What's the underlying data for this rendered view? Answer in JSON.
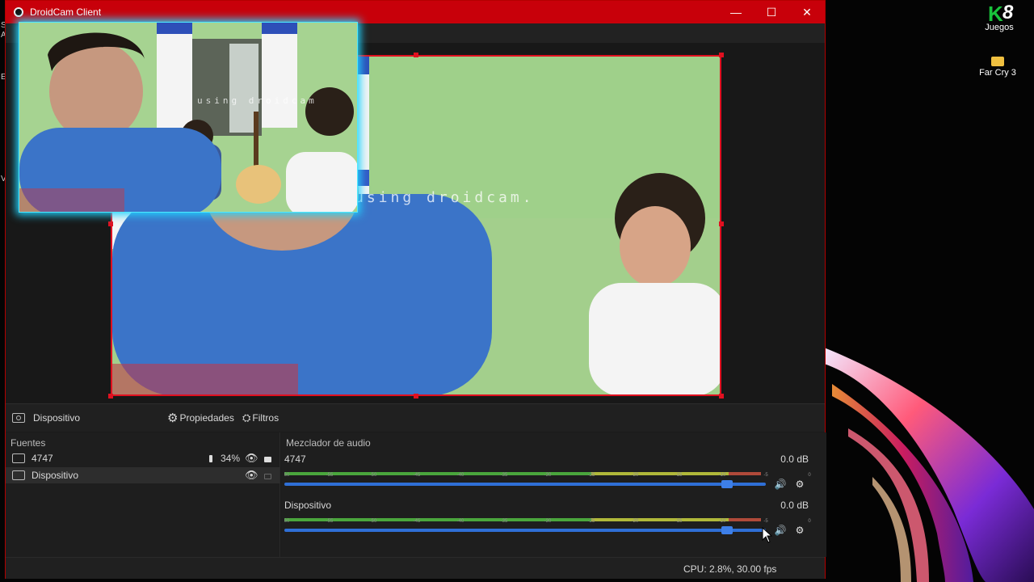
{
  "desktop": {
    "icons": [
      {
        "name": "juegos-shortcut",
        "label": "Juegos",
        "badge": "8",
        "glyph": "K",
        "color": "#19c23b"
      },
      {
        "name": "farcry-folder",
        "label": "Far Cry 3",
        "color": "#f0c040"
      }
    ],
    "edge_letters": [
      "S",
      "A",
      "E",
      "V"
    ]
  },
  "window": {
    "title": "DroidCam Client",
    "accent": "#c8000a",
    "controls": {
      "minimize": "—",
      "maximize": "☐",
      "close": "✕"
    }
  },
  "preview": {
    "watermark": "using droidcam.",
    "pip_watermark": "using droidcam",
    "selection_color": "#e01020",
    "pip_glow_color": "#21d4ff"
  },
  "source_bar": {
    "device_label": "Dispositivo",
    "properties_label": "Propiedades",
    "filters_label": "Filtros"
  },
  "sources": {
    "title": "Fuentes",
    "items": [
      {
        "label": "4747",
        "battery": "34%",
        "visible": true,
        "locked": true
      },
      {
        "label": "Dispositivo",
        "visible": true,
        "locked": false
      }
    ]
  },
  "mixer": {
    "title": "Mezclador de audio",
    "tick_labels": [
      "-60",
      "-55",
      "-50",
      "-45",
      "-40",
      "-35",
      "-30",
      "-25",
      "-20",
      "-15",
      "-10",
      "-5",
      "0"
    ],
    "channels": [
      {
        "name": "4747",
        "db": "0.0 dB",
        "level": 0.92
      },
      {
        "name": "Dispositivo",
        "db": "0.0 dB",
        "level": 0.92
      }
    ]
  },
  "status": {
    "text": "CPU: 2.8%, 30.00 fps"
  }
}
